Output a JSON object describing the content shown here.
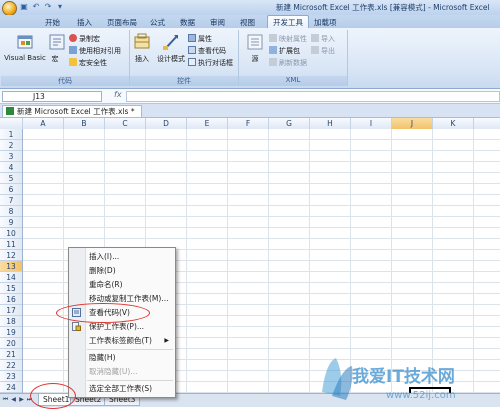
{
  "title_bar": {
    "title": "新建 Microsoft Excel 工作表.xls [兼容模式] - Microsoft Excel"
  },
  "ribbon_tabs": [
    {
      "label": "开始"
    },
    {
      "label": "插入"
    },
    {
      "label": "页面布局"
    },
    {
      "label": "公式"
    },
    {
      "label": "数据"
    },
    {
      "label": "审阅"
    },
    {
      "label": "视图"
    },
    {
      "label": "开发工具",
      "active": true
    },
    {
      "label": "加载项"
    }
  ],
  "ribbon": {
    "code_group": {
      "label": "代码",
      "visual_basic": "Visual Basic",
      "macro": "宏",
      "record_macro": "录制宏",
      "relative_ref": "使用相对引用",
      "macro_security": "宏安全性"
    },
    "controls_group": {
      "label": "控件",
      "insert": "插入",
      "design_mode": "设计模式",
      "properties": "属性",
      "view_code": "查看代码",
      "run_dialog": "执行对话框"
    },
    "xml_group": {
      "label": "XML",
      "source": "源",
      "map_properties": "映射属性",
      "expansion_packs": "扩展包",
      "refresh_data": "刷新数据",
      "import": "导入",
      "export": "导出"
    }
  },
  "formula_bar": {
    "name_box": "J13",
    "fx": "fx",
    "formula": ""
  },
  "workbook": {
    "tab_title": "新建 Microsoft Excel 工作表.xls *"
  },
  "columns": [
    "A",
    "B",
    "C",
    "D",
    "E",
    "F",
    "G",
    "H",
    "I",
    "J",
    "K"
  ],
  "rows": [
    "1",
    "2",
    "3",
    "4",
    "5",
    "6",
    "7",
    "8",
    "9",
    "10",
    "11",
    "12",
    "13",
    "14",
    "15",
    "16",
    "17",
    "18",
    "19",
    "20",
    "21",
    "22",
    "23",
    "24"
  ],
  "selection": {
    "column": "J",
    "row": "13"
  },
  "sheet_tabs": [
    {
      "label": "Sheet1",
      "active": true
    },
    {
      "label": "Sheet2"
    },
    {
      "label": "Sheet3"
    }
  ],
  "context_menu": {
    "items": [
      {
        "label": "插入(I)..."
      },
      {
        "label": "删除(D)"
      },
      {
        "label": "重命名(R)"
      },
      {
        "label": "移动或复制工作表(M)..."
      },
      {
        "label": "查看代码(V)",
        "icon": "view-code-icon"
      },
      {
        "label": "保护工作表(P)...",
        "icon": "protect-sheet-icon"
      },
      {
        "label": "工作表标签颜色(T)",
        "submenu": true
      },
      {
        "label": "隐藏(H)"
      },
      {
        "label": "取消隐藏(U)...",
        "disabled": true
      },
      {
        "label": "选定全部工作表(S)"
      }
    ]
  },
  "watermark": {
    "text": "我爱IT技术网",
    "url": "www.52ij.com"
  },
  "colors": {
    "annotation_red": "#e0302a",
    "selection_orange": "#f2c26a",
    "ribbon_blue": "#d8e5f5"
  }
}
